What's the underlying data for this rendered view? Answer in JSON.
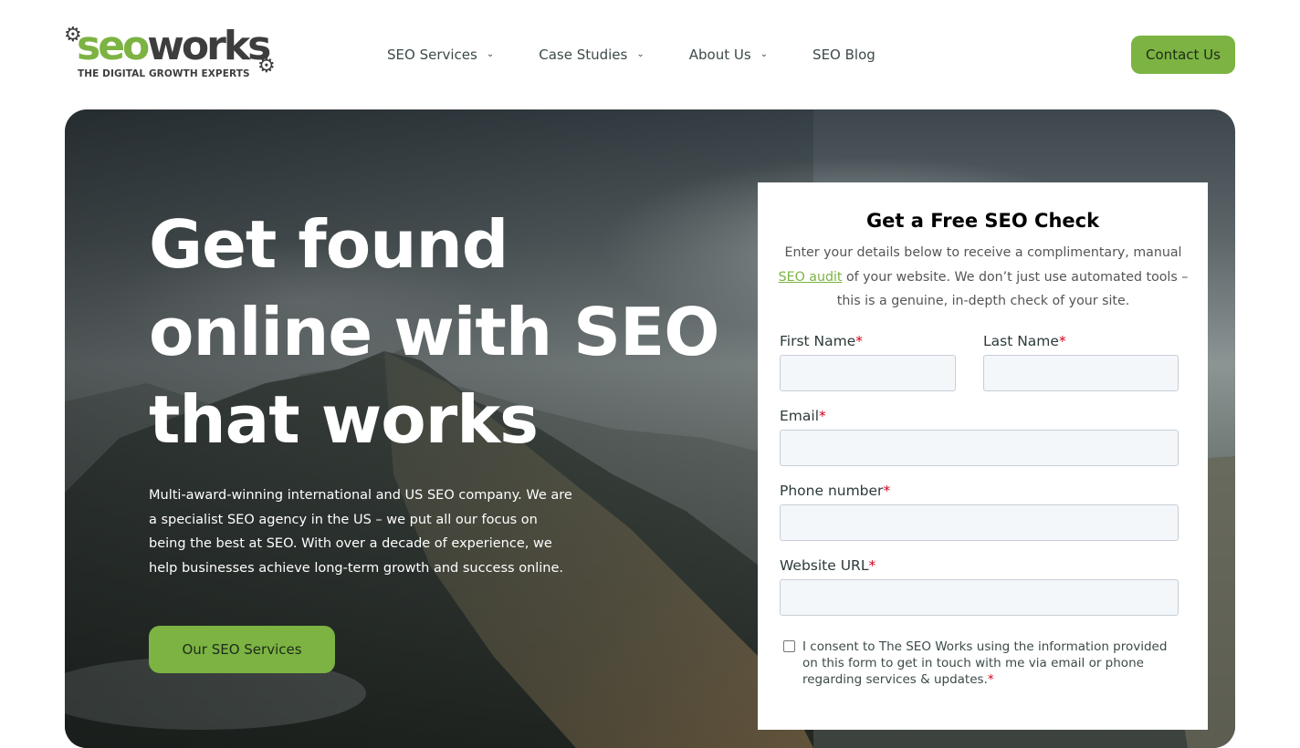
{
  "brand": {
    "logo_seo": "seo",
    "logo_works": "works",
    "tagline": "THE DIGITAL GROWTH EXPERTS",
    "accent_color": "#7cb342"
  },
  "nav": {
    "items": [
      {
        "label": "SEO Services",
        "has_dropdown": true,
        "icon": "chevron-down-icon"
      },
      {
        "label": "Case Studies",
        "has_dropdown": true,
        "icon": "chevron-down-icon"
      },
      {
        "label": "About Us",
        "has_dropdown": true,
        "icon": "chevron-down-icon"
      },
      {
        "label": "SEO Blog",
        "has_dropdown": false
      }
    ],
    "contact_label": "Contact Us"
  },
  "hero": {
    "title_line1": "Get found",
    "title_line2": "online with SEO",
    "title_line3": "that works",
    "description": "Multi-award-winning international and US SEO company. We are a specialist SEO agency in the US – we put all our focus on being the best at SEO. With over a decade of experience, we help businesses achieve long-term growth and success online.",
    "cta_label": "Our SEO Services"
  },
  "form": {
    "title": "Get a Free SEO Check",
    "desc_before": "Enter your details below to receive a complimentary, manual ",
    "desc_link": "SEO audit",
    "desc_after": " of your website. We don’t just use automated tools – this is a genuine, in-depth check of your site.",
    "required_mark": "*",
    "fields": {
      "first_name": {
        "label": "First Name",
        "value": ""
      },
      "last_name": {
        "label": "Last Name",
        "value": ""
      },
      "email": {
        "label": "Email",
        "value": ""
      },
      "phone": {
        "label": "Phone number",
        "value": ""
      },
      "website": {
        "label": "Website URL",
        "value": ""
      }
    },
    "consent": {
      "text": "I consent to The SEO Works using the information provided on this form to get in touch with me via email or phone regarding services & updates.",
      "checked": false
    }
  }
}
